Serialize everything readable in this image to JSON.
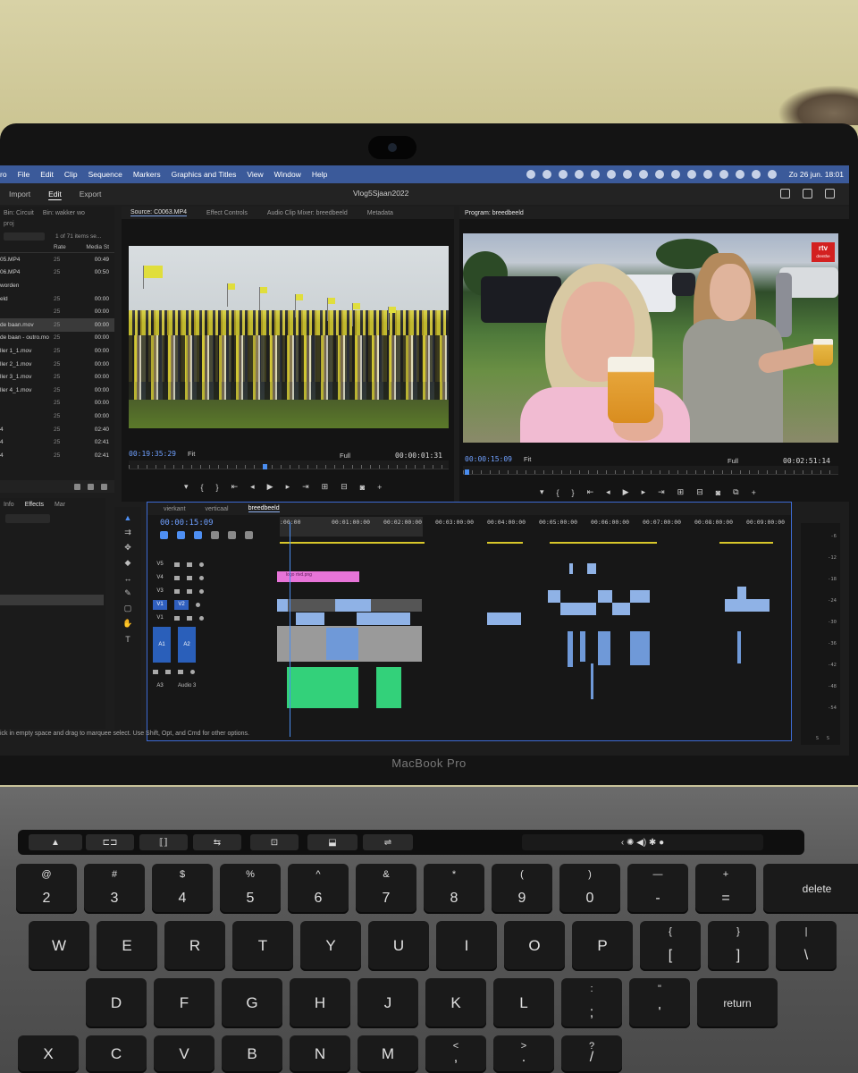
{
  "menubar": {
    "app": "ro",
    "items": [
      "File",
      "Edit",
      "Clip",
      "Sequence",
      "Markers",
      "Graphics and Titles",
      "View",
      "Window",
      "Help"
    ],
    "clock": "Zo 26 jun.  18:01"
  },
  "workspace": {
    "tabs": [
      "Import",
      "Edit",
      "Export"
    ],
    "active": "Edit",
    "title": "Vlog5Sjaan2022"
  },
  "project_panel": {
    "tabs": [
      "Bin: Circuit",
      "Bin: wakker wo"
    ],
    "project_name": "proj",
    "count": "1 of 71 items se...",
    "columns": [
      "Rate",
      "Media St"
    ],
    "rows": [
      {
        "name": "05.MP4",
        "rate": "25",
        "media": "00:49"
      },
      {
        "name": "06.MP4",
        "rate": "25",
        "media": "00:50"
      },
      {
        "name": "worden",
        "rate": "",
        "media": ""
      },
      {
        "name": "eld",
        "rate": "25",
        "media": "00:00"
      },
      {
        "name": "",
        "rate": "25",
        "media": "00:00"
      },
      {
        "name": "de baan.mov",
        "rate": "25",
        "media": "00:00"
      },
      {
        "name": "de baan - outro.mo",
        "rate": "25",
        "media": "00:00"
      },
      {
        "name": "ller 1_1.mov",
        "rate": "25",
        "media": "00:00"
      },
      {
        "name": "ller 2_1.mov",
        "rate": "25",
        "media": "00:00"
      },
      {
        "name": "ller 3_1.mov",
        "rate": "25",
        "media": "00:00"
      },
      {
        "name": "ller 4_1.mov",
        "rate": "25",
        "media": "00:00"
      },
      {
        "name": "",
        "rate": "25",
        "media": "00:00"
      },
      {
        "name": "",
        "rate": "25",
        "media": "00:00"
      },
      {
        "name": "4",
        "rate": "25",
        "media": "02:40"
      },
      {
        "name": "4",
        "rate": "25",
        "media": "02:41"
      },
      {
        "name": "4",
        "rate": "25",
        "media": "02:41"
      }
    ]
  },
  "source_monitor": {
    "tabs": [
      "Source: C0063.MP4",
      "Effect Controls",
      "Audio Clip Mixer: breedbeeld",
      "Metadata"
    ],
    "timecode": "00:19:35:29",
    "fit": "Fit",
    "quality": "Full",
    "duration": "00:00:01:31"
  },
  "program_monitor": {
    "title": "Program: breedbeeld",
    "timecode": "00:00:15:09",
    "fit": "Fit",
    "quality": "Full",
    "duration": "00:02:51:14",
    "logo_text": "rtv",
    "logo_sub": "drenthe"
  },
  "effects_panel": {
    "tabs": [
      "Info",
      "Effects",
      "Mar"
    ]
  },
  "timeline": {
    "tabs": [
      "vierkant",
      "verticaal",
      "breedbeeld"
    ],
    "active": "breedbeeld",
    "timecode": "00:00:15:09",
    "ruler_labels": [
      ":00:00",
      "00:01:00:00",
      "00:02:00:00",
      "00:03:00:00",
      "00:04:00:00",
      "00:05:00:00",
      "00:06:00:00",
      "00:07:00:00",
      "00:08:00:00",
      "00:09:00:00"
    ],
    "video_tracks": [
      "V5",
      "V4",
      "V3",
      "V2",
      "V1"
    ],
    "audio_tracks": [
      "A1",
      "A2",
      "A3"
    ],
    "audio3_name": "Audio 3",
    "graphic_clip": "logo rtvd.png"
  },
  "meter": {
    "labels": [
      "-6",
      "-12",
      "-18",
      "-24",
      "-30",
      "-36",
      "-42",
      "-48",
      "-54"
    ],
    "solo": [
      "S",
      "S"
    ]
  },
  "status": "ick in empty space and drag to marquee select. Use Shift, Opt, and Cmd for other options.",
  "device": "MacBook Pro",
  "keyboard": {
    "number_row": [
      {
        "top": "@",
        "bot": "2"
      },
      {
        "top": "#",
        "bot": "3"
      },
      {
        "top": "$",
        "bot": "4"
      },
      {
        "top": "%",
        "bot": "5"
      },
      {
        "top": "^",
        "bot": "6"
      },
      {
        "top": "&",
        "bot": "7"
      },
      {
        "top": "*",
        "bot": "8"
      },
      {
        "top": "(",
        "bot": "9"
      },
      {
        "top": ")",
        "bot": "0"
      },
      {
        "top": "—",
        "bot": "-"
      },
      {
        "top": "+",
        "bot": "="
      }
    ],
    "delete": "delete",
    "row_q": [
      "W",
      "E",
      "R",
      "T",
      "Y",
      "U",
      "I",
      "O",
      "P"
    ],
    "brackets": [
      {
        "top": "{",
        "bot": "["
      },
      {
        "top": "}",
        "bot": "]"
      },
      {
        "top": "|",
        "bot": "\\"
      }
    ],
    "row_a": [
      "D",
      "F",
      "G",
      "H",
      "J",
      "K",
      "L"
    ],
    "colon": {
      "top": ":",
      "bot": ";"
    },
    "quote": {
      "top": "\"",
      "bot": "'"
    },
    "return": "return",
    "row_z": [
      "X",
      "C",
      "V",
      "B",
      "N",
      "M"
    ],
    "lt": {
      "top": "<",
      "bot": ","
    },
    "gt": {
      "top": ">",
      "bot": "."
    },
    "question": {
      "top": "?",
      "bot": "/"
    }
  }
}
